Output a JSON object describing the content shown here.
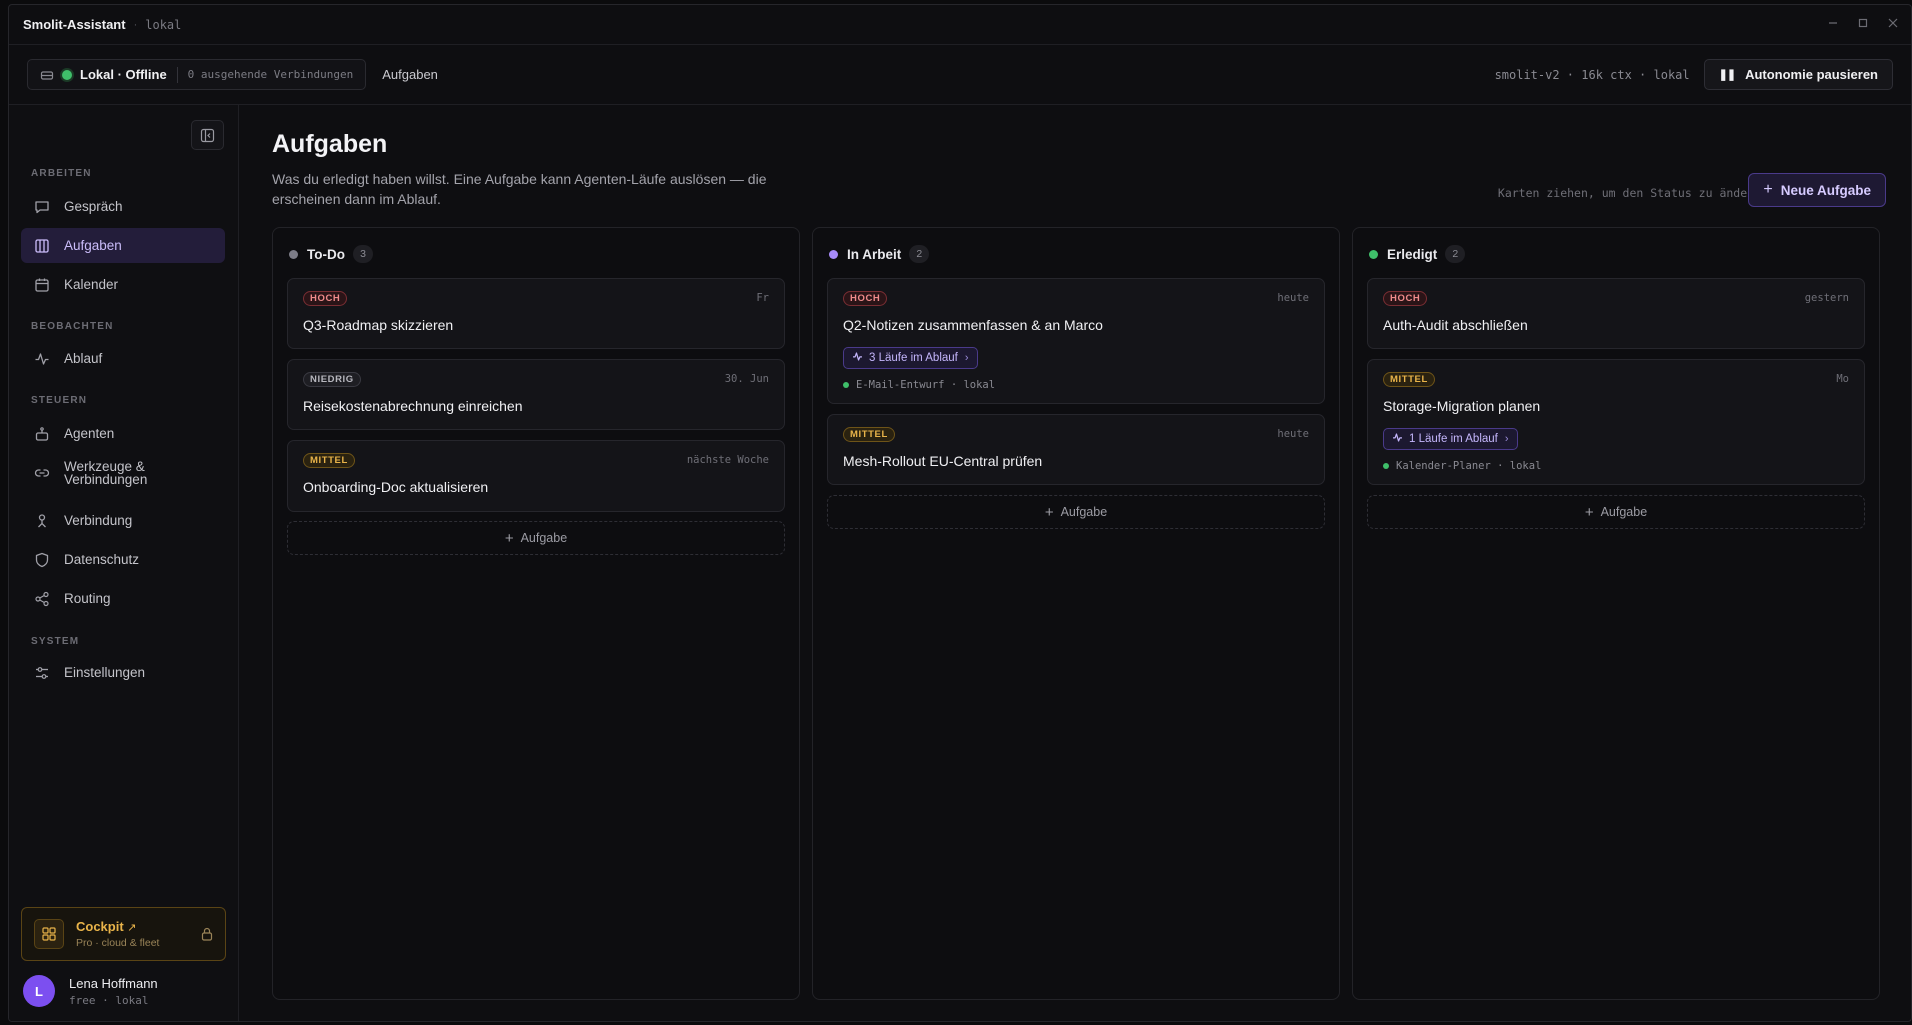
{
  "titlebar": {
    "app_name": "Smolit-Assistant",
    "separator": "·",
    "mode": "lokal"
  },
  "header": {
    "connection_label": "Lokal · Offline",
    "connection_detail": "0 ausgehende Verbindungen",
    "breadcrumb": "Aufgaben",
    "model_info": "smolit-v2 · 16k ctx · lokal",
    "pause_button": "Autonomie pausieren"
  },
  "sidebar": {
    "sections": [
      {
        "label": "ARBEITEN"
      },
      {
        "label": "BEOBACHTEN"
      },
      {
        "label": "STEUERN"
      },
      {
        "label": "SYSTEM"
      }
    ],
    "items": [
      {
        "label": "Gespräch",
        "icon": "chat-icon"
      },
      {
        "label": "Aufgaben",
        "icon": "kanban-icon",
        "active": true
      },
      {
        "label": "Kalender",
        "icon": "calendar-icon"
      },
      {
        "label": "Ablauf",
        "icon": "activity-icon"
      },
      {
        "label": "Agenten",
        "icon": "bot-icon"
      },
      {
        "label_line1": "Werkzeuge &",
        "label_line2": "Verbindungen",
        "icon": "link-icon"
      },
      {
        "label": "Verbindung",
        "icon": "person-icon"
      },
      {
        "label": "Datenschutz",
        "icon": "shield-icon"
      },
      {
        "label": "Routing",
        "icon": "share-icon"
      },
      {
        "label": "Einstellungen",
        "icon": "sliders-icon"
      }
    ],
    "cockpit": {
      "title": "Cockpit",
      "arrow": "↗",
      "subtitle": "Pro · cloud & fleet"
    },
    "user": {
      "initial": "L",
      "name": "Lena Hoffmann",
      "plan": "free · lokal"
    }
  },
  "main": {
    "title": "Aufgaben",
    "description": "Was du erledigt haben willst. Eine Aufgabe kann Agenten-Läufe auslösen — die erscheinen dann im Ablauf.",
    "hint": "Karten ziehen, um den Status zu ändern",
    "new_task_button": "Neue Aufgabe",
    "add_label": "Aufgabe"
  },
  "columns": [
    {
      "title": "To-Do",
      "count": "3",
      "color": "#7d7d88",
      "cards": [
        {
          "priority": "HOCH",
          "due": "Fr",
          "title": "Q3-Roadmap skizzieren"
        },
        {
          "priority": "NIEDRIG",
          "due": "30. Jun",
          "title": "Reisekostenabrechnung einreichen"
        },
        {
          "priority": "MITTEL",
          "due": "nächste Woche",
          "title": "Onboarding-Doc aktualisieren"
        }
      ]
    },
    {
      "title": "In Arbeit",
      "count": "2",
      "color": "#a78bfa",
      "cards": [
        {
          "priority": "HOCH",
          "due": "heute",
          "title": "Q2-Notizen zusammenfassen & an Marco",
          "runs": "3 Läufe im Ablauf",
          "agent": "E-Mail-Entwurf · lokal"
        },
        {
          "priority": "MITTEL",
          "due": "heute",
          "title": "Mesh-Rollout EU-Central prüfen"
        }
      ]
    },
    {
      "title": "Erledigt",
      "count": "2",
      "color": "#3fbf6a",
      "cards": [
        {
          "priority": "HOCH",
          "due": "gestern",
          "title": "Auth-Audit abschließen"
        },
        {
          "priority": "MITTEL",
          "due": "Mo",
          "title": "Storage-Migration planen",
          "runs": "1 Läufe im Ablauf",
          "agent": "Kalender-Planer · lokal"
        }
      ]
    }
  ]
}
